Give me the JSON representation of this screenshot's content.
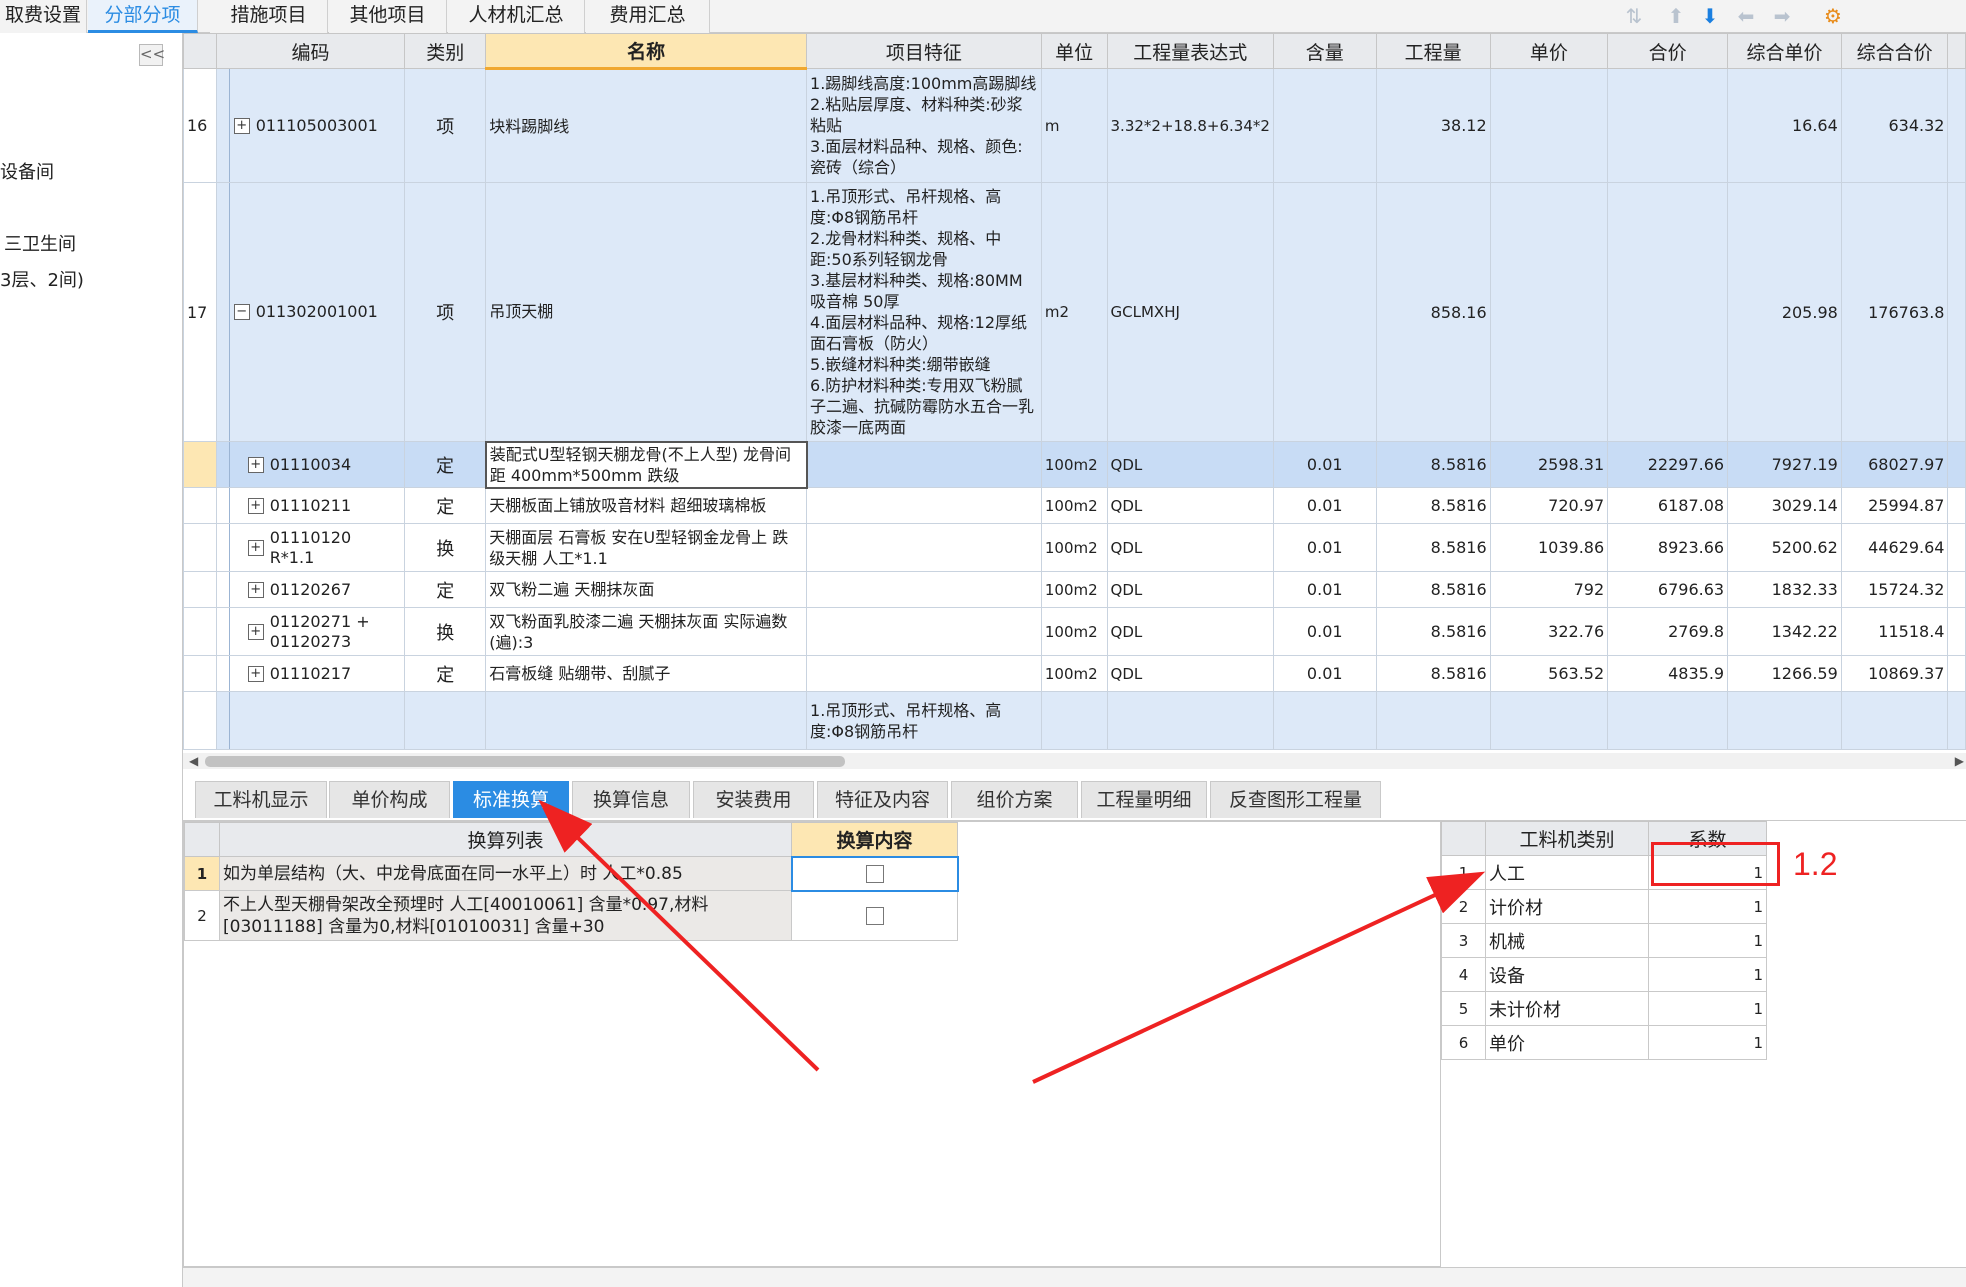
{
  "top_tabs": [
    {
      "label": "取费设置",
      "active": false
    },
    {
      "label": "分部分项",
      "active": true
    },
    {
      "label": "措施项目",
      "active": false
    },
    {
      "label": "其他项目",
      "active": false
    },
    {
      "label": "人材机汇总",
      "active": false
    },
    {
      "label": "费用汇总",
      "active": false
    }
  ],
  "toolbar_icons": [
    "sort-icon",
    "move-up-icon",
    "move-down-icon",
    "move-left-icon",
    "move-right-icon",
    "settings-icon"
  ],
  "tree": {
    "collapse_label": "<<",
    "items": [
      "设备间",
      "三卫生间",
      "3层、2间)"
    ]
  },
  "grid": {
    "columns": [
      "编码",
      "类别",
      "名称",
      "项目特征",
      "单位",
      "工程量表达式",
      "含量",
      "工程量",
      "单价",
      "合价",
      "综合单价",
      "综合合价"
    ],
    "rows": [
      {
        "num": "16",
        "expander": "+",
        "code": "011105003001",
        "type": "项",
        "name": "块料踢脚线",
        "features": "1.踢脚线高度:100mm高踢脚线\n2.粘贴层厚度、材料种类:砂浆粘贴\n3.面层材料品种、规格、颜色:瓷砖（综合）",
        "unit": "m",
        "expr": "3.32*2+18.8+6.34*2",
        "content": "",
        "qty": "38.12",
        "price": "",
        "total": "",
        "comp_price": "16.64",
        "comp_total": "634.32"
      },
      {
        "num": "17",
        "expander": "−",
        "code": "011302001001",
        "type": "项",
        "name": "吊顶天棚",
        "features": "1.吊顶形式、吊杆规格、高度:Φ8钢筋吊杆\n2.龙骨材料种类、规格、中距:50系列轻钢龙骨\n3.基层材料种类、规格:80MM吸音棉 50厚\n4.面层材料品种、规格:12厚纸面石膏板（防火）\n5.嵌缝材料种类:绷带嵌缝\n6.防护材料种类:专用双飞粉腻子二遍、抗碱防霉防水五合一乳胶漆一底两面",
        "unit": "m2",
        "expr": "GCLMXHJ",
        "content": "",
        "qty": "858.16",
        "price": "",
        "total": "",
        "comp_price": "205.98",
        "comp_total": "176763.8"
      },
      {
        "num": "",
        "expander": "+",
        "code": "01110034",
        "type": "定",
        "name": "装配式U型轻钢天棚龙骨(不上人型) 龙骨间距 400mm*500mm 跌级",
        "features": "",
        "unit": "100m2",
        "expr": "QDL",
        "content": "0.01",
        "qty": "8.5816",
        "price": "2598.31",
        "total": "22297.66",
        "comp_price": "7927.19",
        "comp_total": "68027.97"
      },
      {
        "num": "",
        "expander": "+",
        "code": "01110211",
        "type": "定",
        "name": "天棚板面上铺放吸音材料 超细玻璃棉板",
        "features": "",
        "unit": "100m2",
        "expr": "QDL",
        "content": "0.01",
        "qty": "8.5816",
        "price": "720.97",
        "total": "6187.08",
        "comp_price": "3029.14",
        "comp_total": "25994.87"
      },
      {
        "num": "",
        "expander": "+",
        "code": "01110120\nR*1.1",
        "type": "换",
        "name": "天棚面层 石膏板 安在U型轻钢金龙骨上 跌级天棚 人工*1.1",
        "features": "",
        "unit": "100m2",
        "expr": "QDL",
        "content": "0.01",
        "qty": "8.5816",
        "price": "1039.86",
        "total": "8923.66",
        "comp_price": "5200.62",
        "comp_total": "44629.64"
      },
      {
        "num": "",
        "expander": "+",
        "code": "01120267",
        "type": "定",
        "name": "双飞粉二遍 天棚抹灰面",
        "features": "",
        "unit": "100m2",
        "expr": "QDL",
        "content": "0.01",
        "qty": "8.5816",
        "price": "792",
        "total": "6796.63",
        "comp_price": "1832.33",
        "comp_total": "15724.32"
      },
      {
        "num": "",
        "expander": "+",
        "code": "01120271 +\n01120273",
        "type": "换",
        "name": "双飞粉面乳胶漆二遍 天棚抹灰面  实际遍数(遍):3",
        "features": "",
        "unit": "100m2",
        "expr": "QDL",
        "content": "0.01",
        "qty": "8.5816",
        "price": "322.76",
        "total": "2769.8",
        "comp_price": "1342.22",
        "comp_total": "11518.4"
      },
      {
        "num": "",
        "expander": "+",
        "code": "01110217",
        "type": "定",
        "name": "石膏板缝 贴绷带、刮腻子",
        "features": "",
        "unit": "100m2",
        "expr": "QDL",
        "content": "0.01",
        "qty": "8.5816",
        "price": "563.52",
        "total": "4835.9",
        "comp_price": "1266.59",
        "comp_total": "10869.37"
      },
      {
        "num": "",
        "expander": "",
        "code": "",
        "type": "",
        "name": "",
        "features": "1.吊顶形式、吊杆规格、高度:Φ8钢筋吊杆",
        "unit": "",
        "expr": "",
        "content": "",
        "qty": "",
        "price": "",
        "total": "",
        "comp_price": "",
        "comp_total": ""
      }
    ]
  },
  "bottom_tabs": [
    {
      "label": "工料机显示",
      "active": false
    },
    {
      "label": "单价构成",
      "active": false
    },
    {
      "label": "标准换算",
      "active": true
    },
    {
      "label": "换算信息",
      "active": false
    },
    {
      "label": "安装费用",
      "active": false
    },
    {
      "label": "特征及内容",
      "active": false
    },
    {
      "label": "组价方案",
      "active": false
    },
    {
      "label": "工程量明细",
      "active": false
    },
    {
      "label": "反查图形工程量",
      "active": false
    }
  ],
  "conversion": {
    "header_list": "换算列表",
    "header_content": "换算内容",
    "rows": [
      {
        "num": "1",
        "text": "如为单层结构（大、中龙骨底面在同一水平上）时 人工*0.85",
        "checked": false
      },
      {
        "num": "2",
        "text": "不上人型天棚骨架改全预埋时 人工[40010061] 含量*0.97,材料[03011188] 含量为0,材料[01010031] 含量+30",
        "checked": false
      }
    ]
  },
  "categories": {
    "header_type": "工料机类别",
    "header_coef": "系数",
    "rows": [
      {
        "num": "1",
        "type": "人工",
        "coef": "1"
      },
      {
        "num": "2",
        "type": "计价材",
        "coef": "1"
      },
      {
        "num": "3",
        "type": "机械",
        "coef": "1"
      },
      {
        "num": "4",
        "type": "设备",
        "coef": "1"
      },
      {
        "num": "5",
        "type": "未计价材",
        "coef": "1"
      },
      {
        "num": "6",
        "type": "单价",
        "coef": "1"
      }
    ]
  },
  "annotation": {
    "text": "1.2",
    "color": "#ee2222"
  }
}
